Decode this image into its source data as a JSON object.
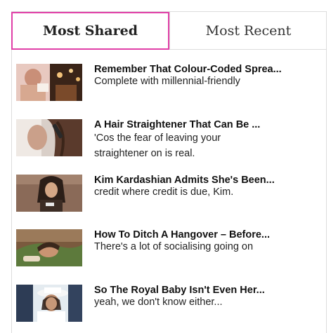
{
  "tabs": {
    "most_shared": "Most Shared",
    "most_recent": "Most Recent",
    "active": "most_shared",
    "active_border_color": "#e03fa7"
  },
  "articles": [
    {
      "title": "Remember That Colour-Coded Sprea...",
      "teaser": "Complete with millennial-friendly",
      "thumb_icon": "woman-restaurant-photo"
    },
    {
      "title": "A Hair Straightener That Can Be ...",
      "teaser": "'Cos the fear of leaving your straightener on is real.",
      "thumb_icon": "hair-straightener-photo"
    },
    {
      "title": "Kim Kardashian Admits She's Been...",
      "teaser": "credit where credit is due, Kim.",
      "thumb_icon": "kim-kardashian-photo"
    },
    {
      "title": "How To Ditch A Hangover – Before...",
      "teaser": "There's a lot of socialising going on",
      "thumb_icon": "hangover-bed-photo"
    },
    {
      "title": "So The Royal Baby Isn't Even Her...",
      "teaser": "yeah, we don't know either...",
      "thumb_icon": "royal-woman-hat-photo"
    }
  ]
}
